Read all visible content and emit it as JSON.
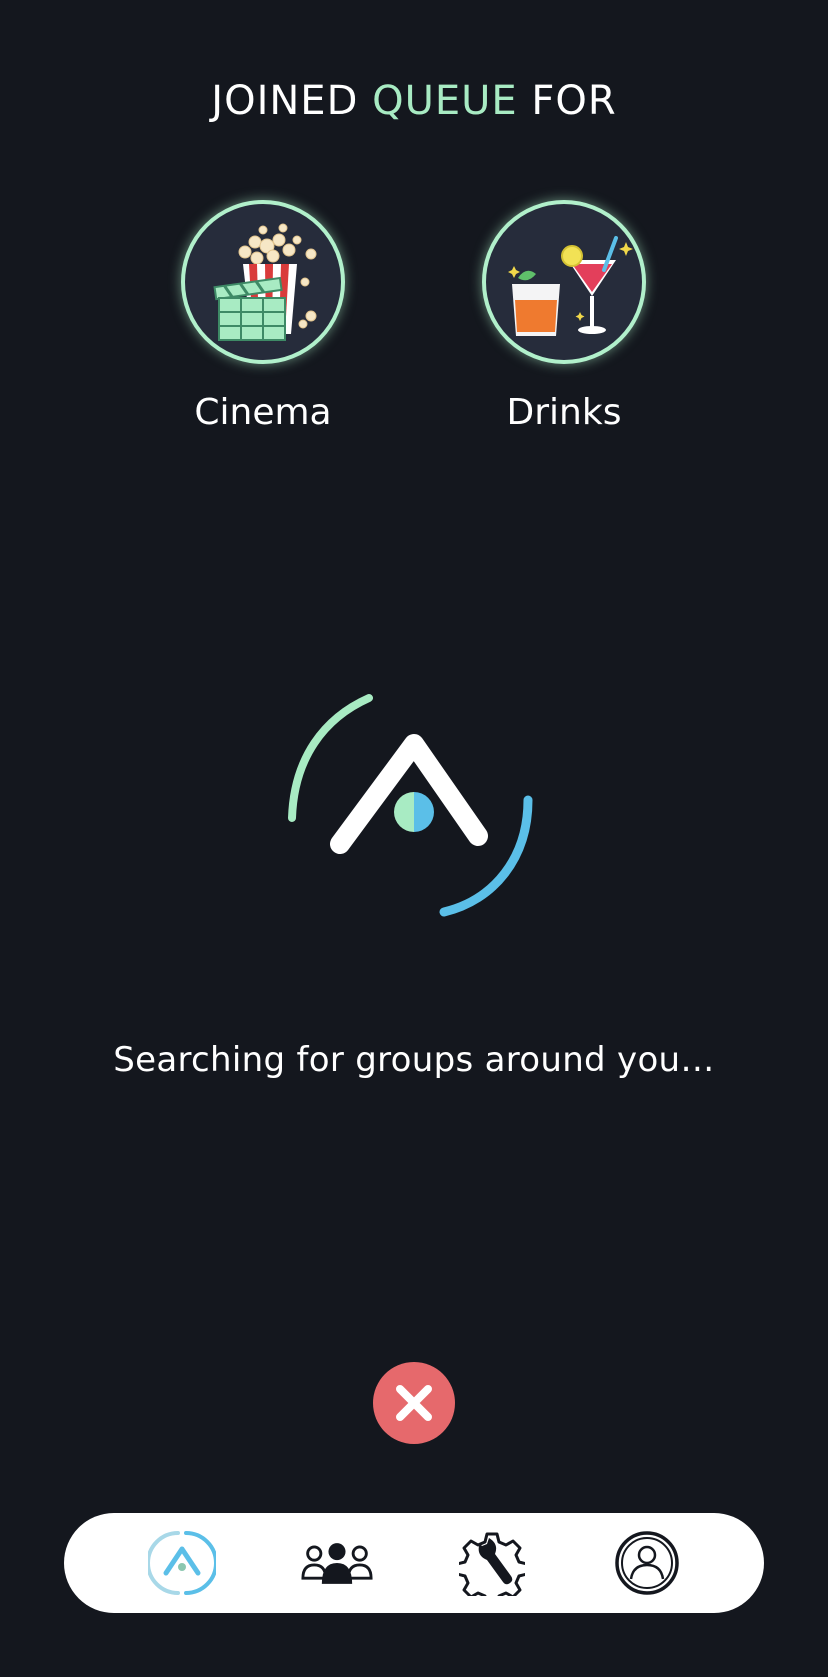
{
  "heading": {
    "prefix": "JOINED ",
    "accent": "QUEUE",
    "suffix": " FOR"
  },
  "categories": [
    {
      "label": "Cinema",
      "icon": "popcorn-clapperboard-icon"
    },
    {
      "label": "Drinks",
      "icon": "cocktail-glasses-icon"
    }
  ],
  "status_text": "Searching for groups around you…",
  "cancel": {
    "icon": "close-icon"
  },
  "nav": {
    "items": [
      {
        "name": "home",
        "icon": "app-logo-icon",
        "active": true
      },
      {
        "name": "groups",
        "icon": "people-icon",
        "active": false
      },
      {
        "name": "settings",
        "icon": "wrench-gear-icon",
        "active": false
      },
      {
        "name": "profile",
        "icon": "user-icon",
        "active": false
      }
    ]
  },
  "colors": {
    "background": "#14171e",
    "accent_green": "#a8ebc3",
    "accent_blue": "#5bbfe8",
    "cancel_red": "#e6696c",
    "nav_background": "#ffffff"
  }
}
